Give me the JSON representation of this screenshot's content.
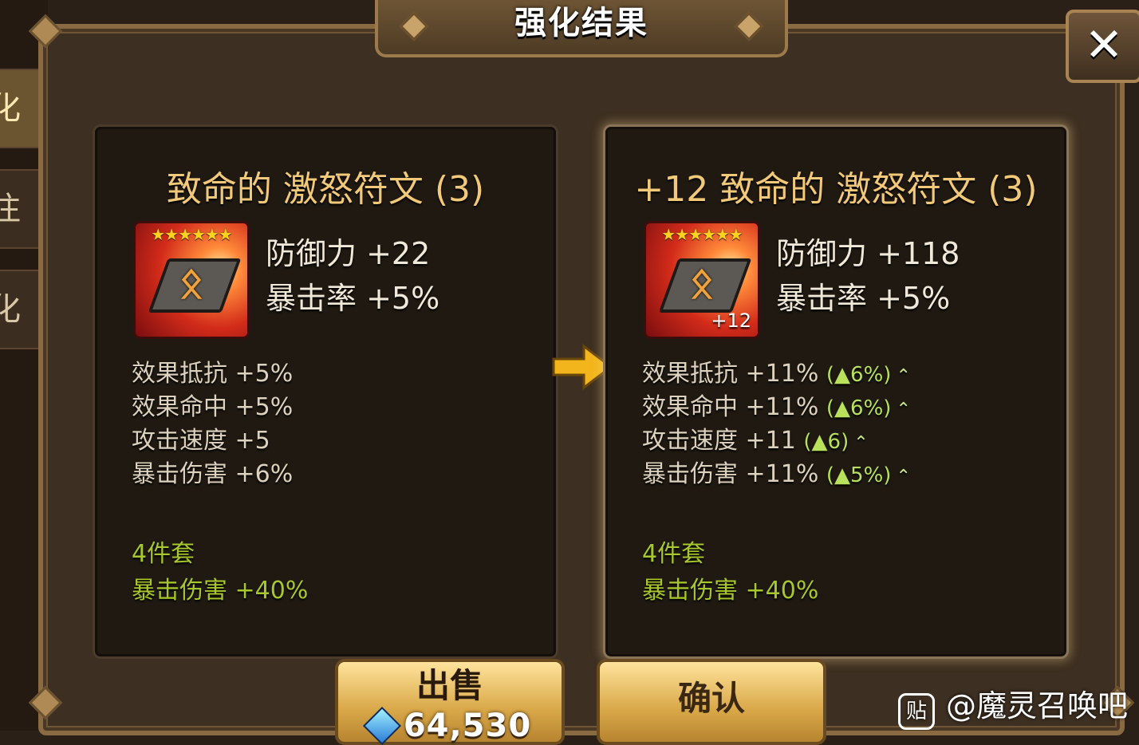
{
  "side_tabs": [
    "化",
    "注入",
    "化"
  ],
  "title": "强化结果",
  "close_label": "✕",
  "before": {
    "name": "致命的 激怒符文 (3)",
    "stars": "★★★★★★",
    "main_stats": [
      "防御力 +22",
      "暴击率 +5%"
    ],
    "sub_stats": [
      "效果抵抗 +5%",
      "效果命中 +5%",
      "攻击速度 +5",
      "暴击伤害 +6%"
    ],
    "set_name": "4件套",
    "set_bonus": "暴击伤害 +40%"
  },
  "after": {
    "name": "+12 致命的 激怒符文 (3)",
    "stars": "★★★★★★",
    "level_badge": "+12",
    "main_stats": [
      "防御力 +118",
      "暴击率 +5%"
    ],
    "sub_stats": [
      {
        "text": "效果抵抗 +11%",
        "diff": "(▲6%)"
      },
      {
        "text": "效果命中 +11%",
        "diff": "(▲6%)"
      },
      {
        "text": "攻击速度 +11",
        "diff": "(▲6)"
      },
      {
        "text": "暴击伤害 +11%",
        "diff": "(▲5%)"
      }
    ],
    "set_name": "4件套",
    "set_bonus": "暴击伤害 +40%"
  },
  "sell_button": {
    "label": "出售",
    "price": "64,530"
  },
  "confirm_button": {
    "label": "确认"
  },
  "watermark": {
    "icon": "贴",
    "text": "@魔灵召唤吧"
  }
}
